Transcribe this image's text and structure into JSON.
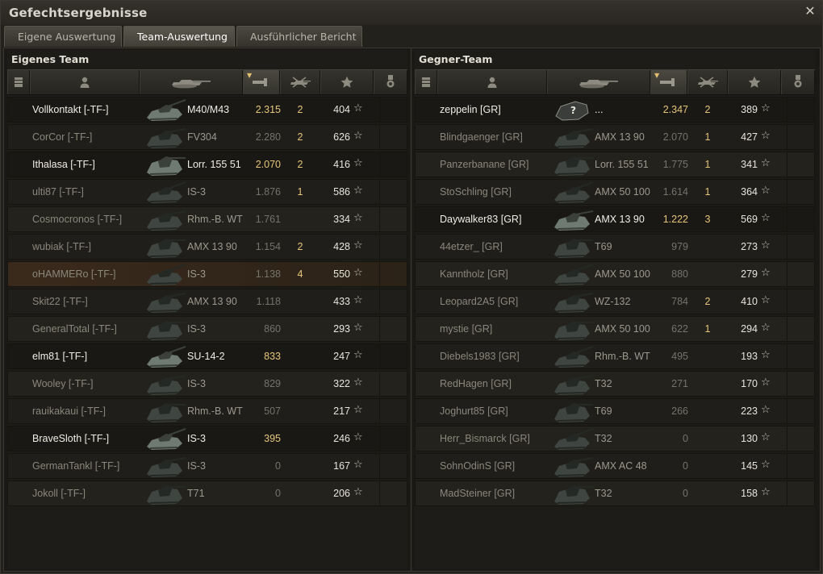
{
  "window": {
    "title": "Gefechtsergebnisse"
  },
  "tabs": [
    {
      "label": "Eigene Auswertung",
      "active": false
    },
    {
      "label": "Team-Auswertung",
      "active": true
    },
    {
      "label": "Ausführlicher Bericht",
      "active": false
    }
  ],
  "columns": [
    "platoon-icon",
    "player-icon",
    "tank-icon",
    "damage-icon",
    "kills-icon",
    "xp-star-icon",
    "medal-icon"
  ],
  "teams": [
    {
      "title": "Eigenes Team",
      "players": [
        {
          "name": "Vollkontakt [-TF-]",
          "tank": "M40/M43",
          "damage": "2.315",
          "kills": "2",
          "xp": "404",
          "alive": true
        },
        {
          "name": "CorCor [-TF-]",
          "tank": "FV304",
          "damage": "2.280",
          "kills": "2",
          "xp": "626",
          "alive": false
        },
        {
          "name": "Ithalasa [-TF-]",
          "tank": "Lorr. 155 51",
          "damage": "2.070",
          "kills": "2",
          "xp": "416",
          "alive": true
        },
        {
          "name": "ulti87 [-TF-]",
          "tank": "IS-3",
          "damage": "1.876",
          "kills": "1",
          "xp": "586",
          "alive": false
        },
        {
          "name": "Cosmocronos [-TF-]",
          "tank": "Rhm.-B. WT",
          "damage": "1.761",
          "kills": "",
          "xp": "334",
          "alive": false
        },
        {
          "name": "wubiak [-TF-]",
          "tank": "AMX 13 90",
          "damage": "1.154",
          "kills": "2",
          "xp": "428",
          "alive": false
        },
        {
          "name": "oHAMMERo [-TF-]",
          "tank": "IS-3",
          "damage": "1.138",
          "kills": "4",
          "xp": "550",
          "alive": false,
          "highlight": true
        },
        {
          "name": "Skit22 [-TF-]",
          "tank": "AMX 13 90",
          "damage": "1.118",
          "kills": "",
          "xp": "433",
          "alive": false
        },
        {
          "name": "GeneralTotal [-TF-]",
          "tank": "IS-3",
          "damage": "860",
          "kills": "",
          "xp": "293",
          "alive": false
        },
        {
          "name": "elm81 [-TF-]",
          "tank": "SU-14-2",
          "damage": "833",
          "kills": "",
          "xp": "247",
          "alive": true
        },
        {
          "name": "Wooley [-TF-]",
          "tank": "IS-3",
          "damage": "829",
          "kills": "",
          "xp": "322",
          "alive": false
        },
        {
          "name": "rauikakaui [-TF-]",
          "tank": "Rhm.-B. WT",
          "damage": "507",
          "kills": "",
          "xp": "217",
          "alive": false
        },
        {
          "name": "BraveSloth [-TF-]",
          "tank": "IS-3",
          "damage": "395",
          "kills": "",
          "xp": "246",
          "alive": true
        },
        {
          "name": "GermanTankl [-TF-]",
          "tank": "IS-3",
          "damage": "0",
          "kills": "",
          "xp": "167",
          "alive": false
        },
        {
          "name": "Jokoll [-TF-]",
          "tank": "T71",
          "damage": "0",
          "kills": "",
          "xp": "206",
          "alive": false
        }
      ]
    },
    {
      "title": "Gegner-Team",
      "players": [
        {
          "name": "zeppelin [GR]",
          "tank": "...",
          "damage": "2.347",
          "kills": "2",
          "xp": "389",
          "alive": true,
          "unknown_tank": true,
          "unknown_mark": "?"
        },
        {
          "name": "Blindgaenger [GR]",
          "tank": "AMX 13 90",
          "damage": "2.070",
          "kills": "1",
          "xp": "427",
          "alive": false
        },
        {
          "name": "Panzerbanane [GR]",
          "tank": "Lorr. 155 51",
          "damage": "1.775",
          "kills": "1",
          "xp": "341",
          "alive": false
        },
        {
          "name": "StoSchling [GR]",
          "tank": "AMX 50 100",
          "damage": "1.614",
          "kills": "1",
          "xp": "364",
          "alive": false
        },
        {
          "name": "Daywalker83 [GR]",
          "tank": "AMX 13 90",
          "damage": "1.222",
          "kills": "3",
          "xp": "569",
          "alive": true
        },
        {
          "name": "44etzer_ [GR]",
          "tank": "T69",
          "damage": "979",
          "kills": "",
          "xp": "273",
          "alive": false
        },
        {
          "name": "Kanntholz [GR]",
          "tank": "AMX 50 100",
          "damage": "880",
          "kills": "",
          "xp": "279",
          "alive": false
        },
        {
          "name": "Leopard2A5 [GR]",
          "tank": "WZ-132",
          "damage": "784",
          "kills": "2",
          "xp": "410",
          "alive": false
        },
        {
          "name": "mystie [GR]",
          "tank": "AMX 50 100",
          "damage": "622",
          "kills": "1",
          "xp": "294",
          "alive": false
        },
        {
          "name": "Diebels1983 [GR]",
          "tank": "Rhm.-B. WT",
          "damage": "495",
          "kills": "",
          "xp": "193",
          "alive": false
        },
        {
          "name": "RedHagen [GR]",
          "tank": "T32",
          "damage": "271",
          "kills": "",
          "xp": "170",
          "alive": false
        },
        {
          "name": "Joghurt85 [GR]",
          "tank": "T69",
          "damage": "266",
          "kills": "",
          "xp": "223",
          "alive": false
        },
        {
          "name": "Herr_Bismarck [GR]",
          "tank": "T32",
          "damage": "0",
          "kills": "",
          "xp": "130",
          "alive": false
        },
        {
          "name": "SohnOdinS [GR]",
          "tank": "AMX AC 48",
          "damage": "0",
          "kills": "",
          "xp": "145",
          "alive": false
        },
        {
          "name": "MadSteiner [GR]",
          "tank": "T32",
          "damage": "0",
          "kills": "",
          "xp": "158",
          "alive": false
        }
      ]
    }
  ],
  "colors": {
    "damage_alive": "#e6c67a",
    "name_alive": "#f0eee4",
    "name_dead": "#8a877b",
    "highlight_row": "#3a2a1c"
  }
}
